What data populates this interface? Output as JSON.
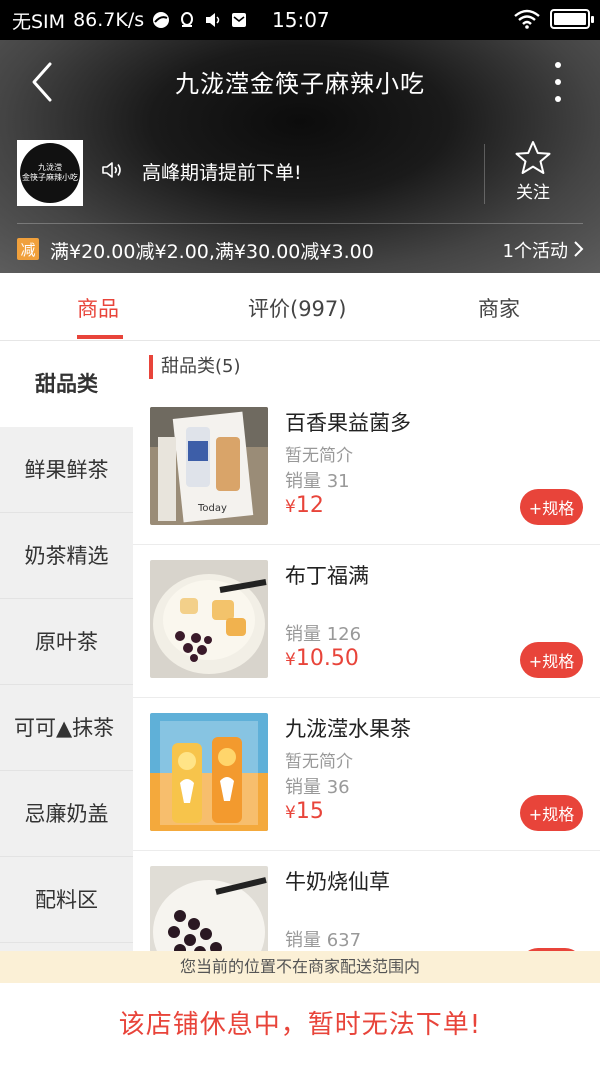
{
  "status_bar": {
    "carrier": "无SIM",
    "speed": "86.7K/s",
    "time": "15:07"
  },
  "header": {
    "title": "九泷滢金筷子麻辣小吃",
    "logo_text_line1": "九泷滢",
    "logo_text_line2": "金筷子麻辣小吃",
    "notice": "高峰期请提前下单!",
    "follow_label": "关注",
    "promo_badge": "减",
    "promo_text": "满¥20.00减¥2.00,满¥30.00减¥3.00",
    "promo_activities": "1个活动"
  },
  "tabs": [
    {
      "label": "商品",
      "active": true
    },
    {
      "label": "评价(997)",
      "active": false
    },
    {
      "label": "商家",
      "active": false
    }
  ],
  "sidebar": {
    "items": [
      {
        "label": "甜品类",
        "active": true
      },
      {
        "label": "鲜果鲜茶",
        "active": false
      },
      {
        "label": "奶茶精选",
        "active": false
      },
      {
        "label": "原叶茶",
        "active": false
      },
      {
        "label": "可可▲抹茶",
        "active": false
      },
      {
        "label": "忌廉奶盖",
        "active": false
      },
      {
        "label": "配料区",
        "active": false
      }
    ]
  },
  "content": {
    "category_title": "甜品类(5)",
    "items": [
      {
        "name": "百香果益菌多",
        "desc": "暂无简介",
        "sales": "销量 31",
        "currency": "¥",
        "price": "12",
        "button": "+规格"
      },
      {
        "name": "布丁福满",
        "desc": "",
        "sales": "销量 126",
        "currency": "¥",
        "price": "10.50",
        "button": "+规格"
      },
      {
        "name": "九泷滢水果茶",
        "desc": "暂无简介",
        "sales": "销量 36",
        "currency": "¥",
        "price": "15",
        "button": "+规格"
      },
      {
        "name": "牛奶烧仙草",
        "desc": "",
        "sales": "销量 637",
        "currency": "¥",
        "price": "",
        "button": ""
      }
    ]
  },
  "bottom": {
    "range_notice": "您当前的位置不在商家配送范围内",
    "closed_text": "该店铺休息中，暂时无法下单!"
  },
  "colors": {
    "accent": "#e8443a",
    "promo_badge": "#f0a03c",
    "notice_bg": "#fbf0d6"
  }
}
